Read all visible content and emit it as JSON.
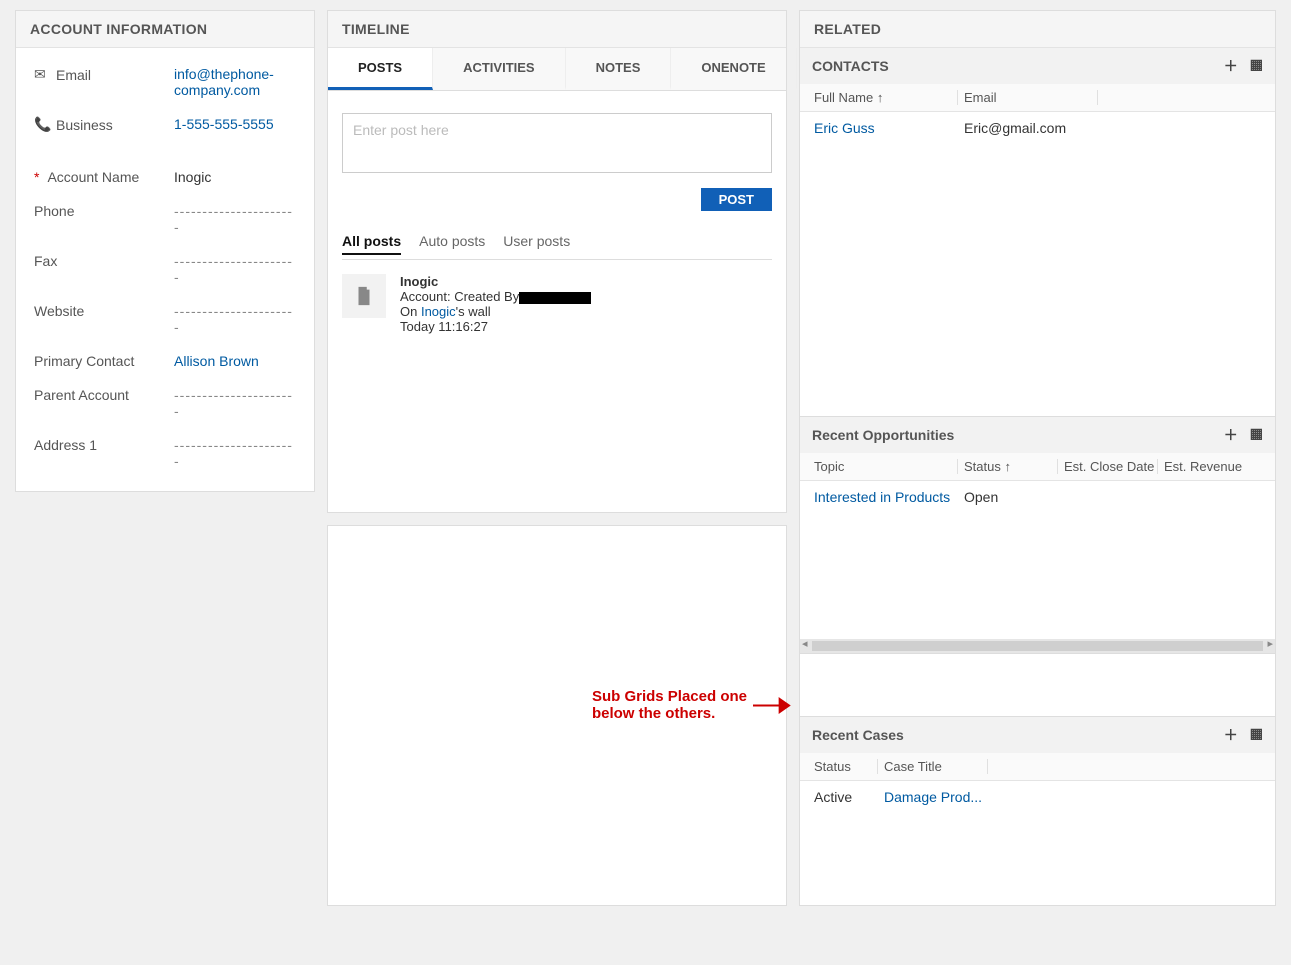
{
  "account": {
    "header": "ACCOUNT INFORMATION",
    "email_label": "Email",
    "email_value": "info@thephone-company.com",
    "business_label": "Business",
    "business_value": "1-555-555-5555",
    "fields": {
      "account_name": {
        "label": "Account Name",
        "value": "Inogic"
      },
      "phone": {
        "label": "Phone",
        "value": "----------------------"
      },
      "fax": {
        "label": "Fax",
        "value": "----------------------"
      },
      "website": {
        "label": "Website",
        "value": "----------------------"
      },
      "primary": {
        "label": "Primary Contact",
        "value": "Allison Brown"
      },
      "parent": {
        "label": "Parent Account",
        "value": "----------------------"
      },
      "address": {
        "label": "Address 1",
        "value": "----------------------"
      }
    }
  },
  "timeline": {
    "header": "TIMELINE",
    "tabs": {
      "posts": "POSTS",
      "activities": "ACTIVITIES",
      "notes": "NOTES",
      "onenote": "ONENOTE"
    },
    "post_placeholder": "Enter post here",
    "post_button": "POST",
    "filters": {
      "all": "All posts",
      "auto": "Auto posts",
      "user": "User posts"
    },
    "entry": {
      "title": "Inogic",
      "line1_prefix": "Account: Created By",
      "line2_prefix": "On ",
      "line2_link": "Inogic",
      "line2_suffix": "'s wall",
      "line3": "Today 11:16:27"
    }
  },
  "related": {
    "header": "RELATED",
    "contacts": {
      "title": "CONTACTS",
      "cols": {
        "name": "Full Name ↑",
        "email": "Email"
      },
      "row": {
        "name": "Eric Guss",
        "email": "Eric@gmail.com"
      }
    },
    "opps": {
      "title": "Recent Opportunities",
      "cols": {
        "topic": "Topic",
        "status": "Status ↑",
        "ecd": "Est. Close Date",
        "erev": "Est. Revenue"
      },
      "row": {
        "topic": "Interested in Products",
        "status": "Open"
      }
    },
    "cases": {
      "title": "Recent Cases",
      "cols": {
        "status": "Status",
        "title": "Case Title"
      },
      "row": {
        "status": "Active",
        "title": "Damage Prod..."
      }
    }
  },
  "annotation": {
    "line1": "Sub Grids Placed one",
    "line2": "below the others."
  }
}
